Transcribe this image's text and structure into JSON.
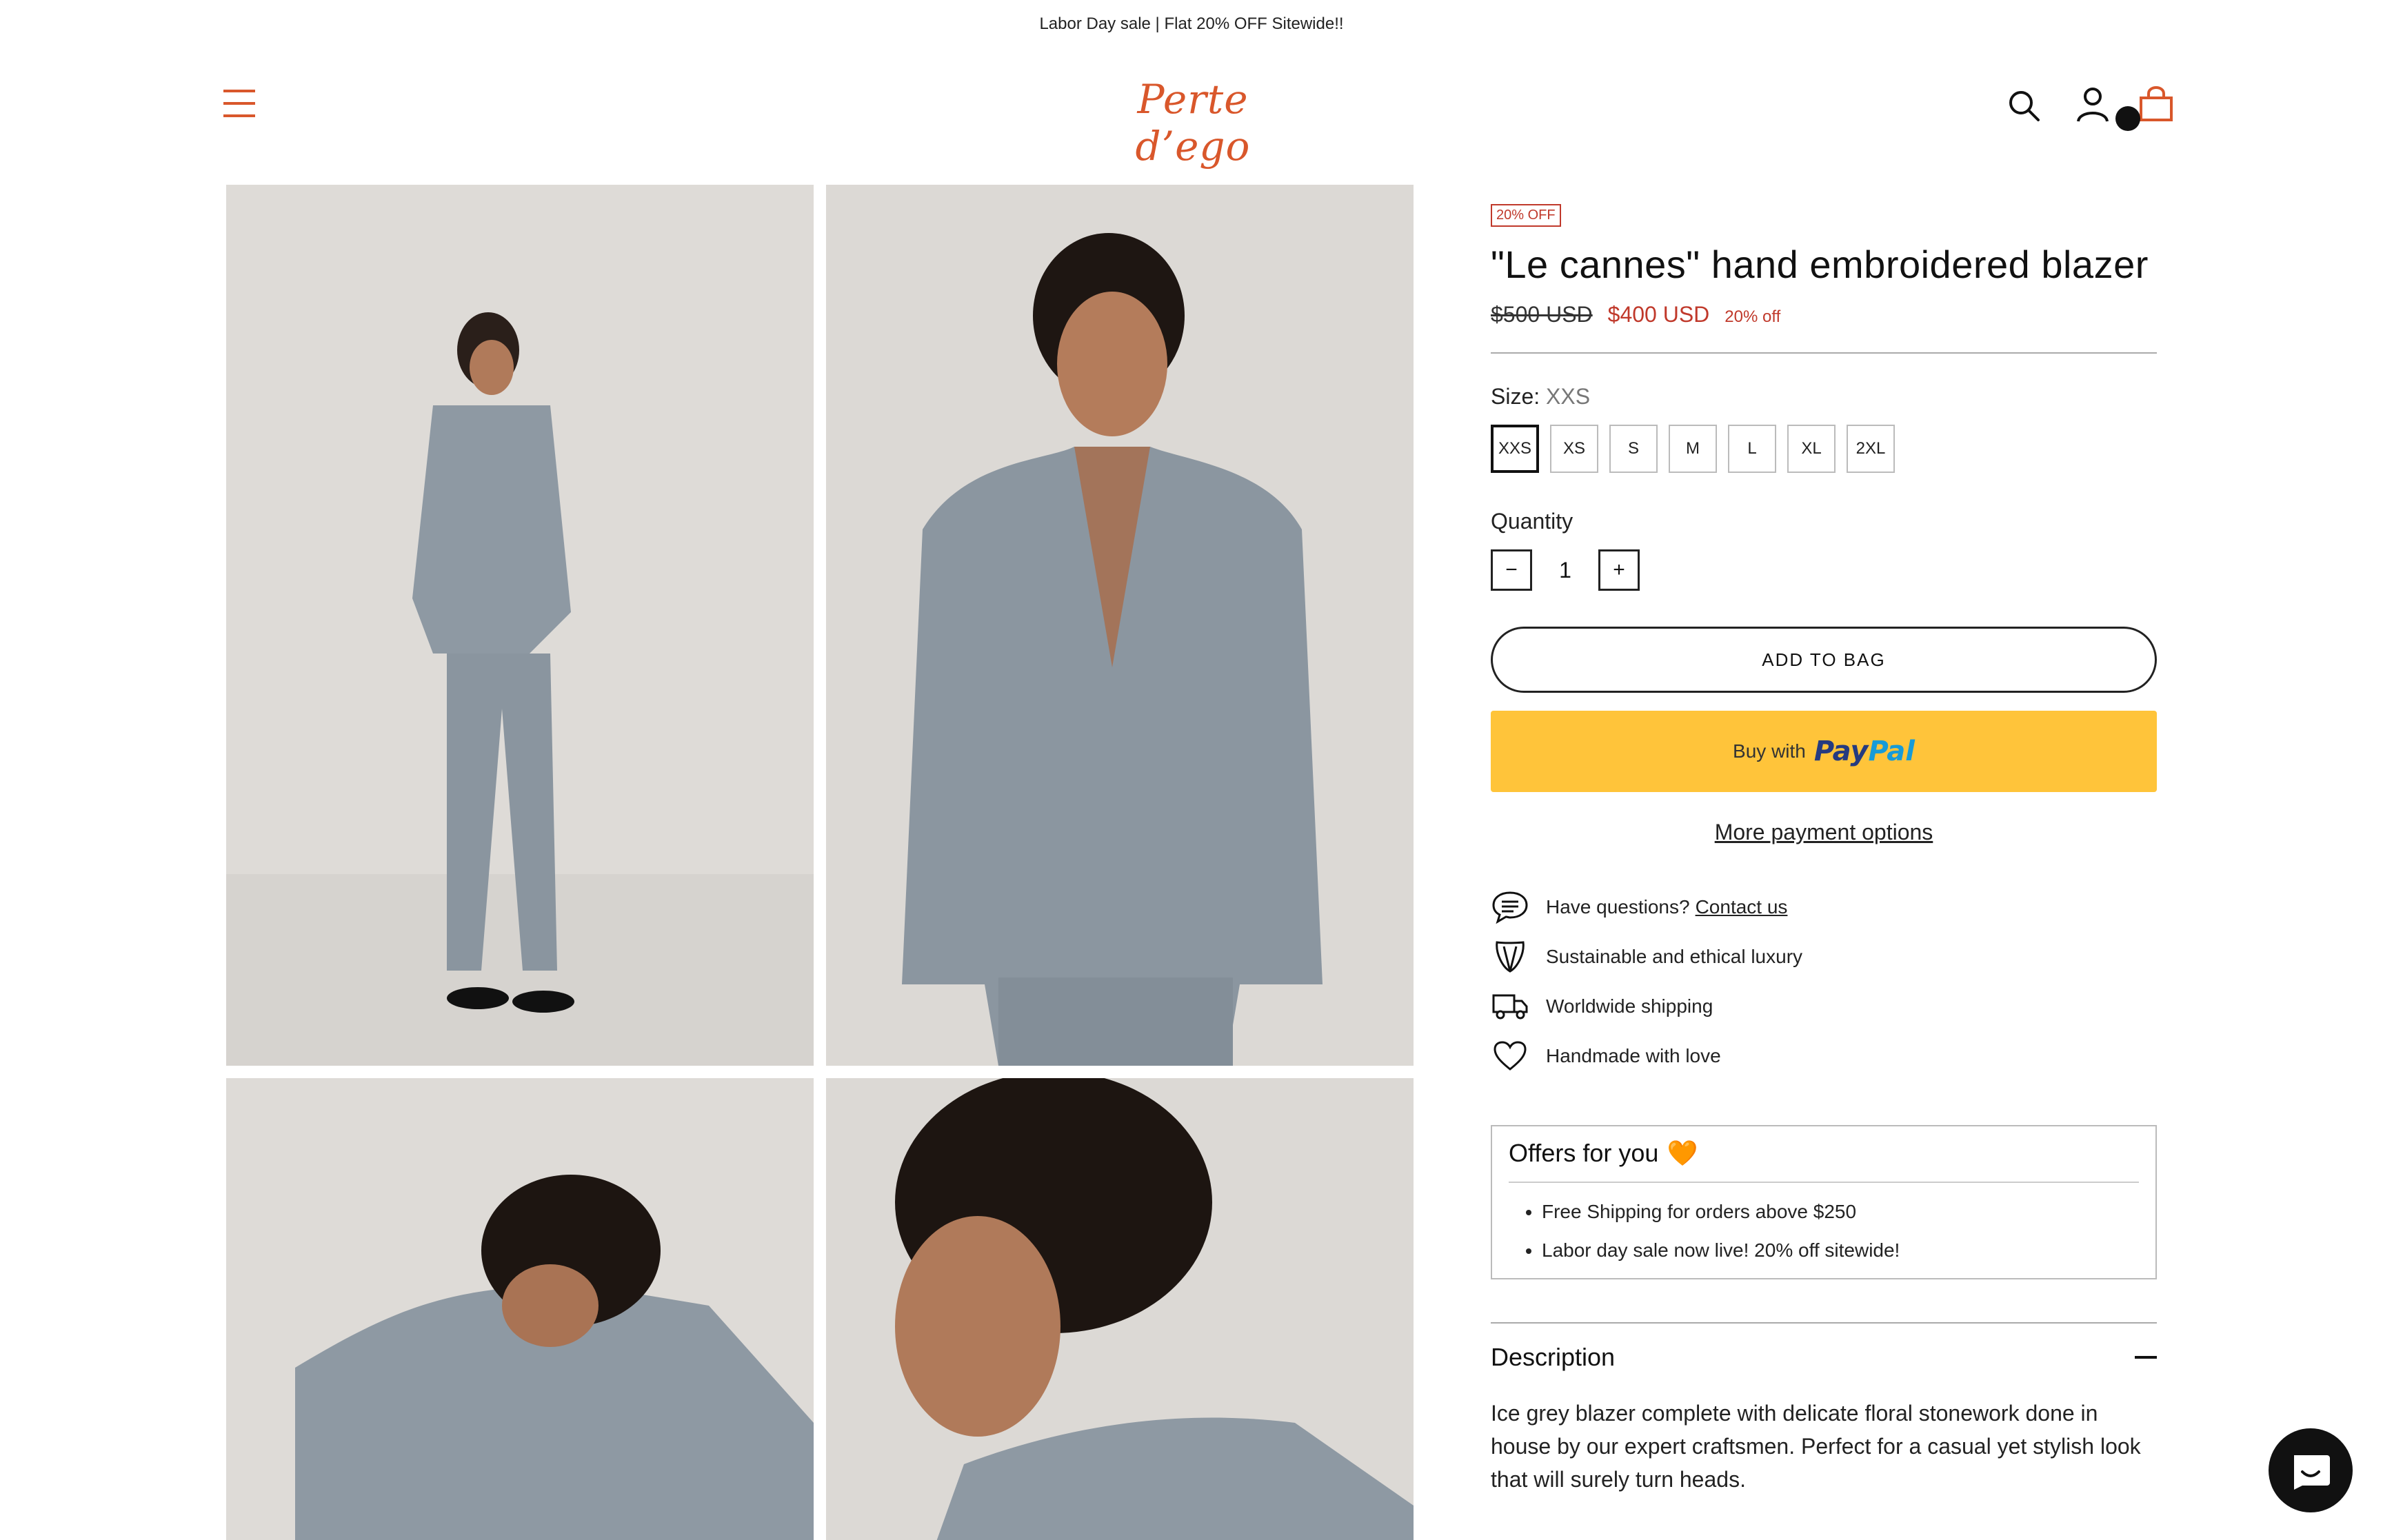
{
  "announcement": "Labor Day sale | Flat 20% OFF Sitewide!!",
  "header": {
    "logo": "Perte d’ego"
  },
  "product": {
    "badge": "20% OFF",
    "title": "\"Le cannes\" hand embroidered blazer",
    "old_price": "$500 USD",
    "new_price": "$400 USD",
    "discount": "20% off",
    "size_label": "Size:",
    "selected_size": "XXS",
    "sizes": [
      "XXS",
      "XS",
      "S",
      "M",
      "L",
      "XL",
      "2XL"
    ],
    "quantity_label": "Quantity",
    "quantity": "1",
    "minus": "−",
    "plus": "+",
    "add_to_bag": "ADD TO BAG",
    "buy_with": "Buy with",
    "paypal_a": "Pay",
    "paypal_b": "Pal",
    "more_payment": "More payment options"
  },
  "features": {
    "questions": "Have questions?",
    "contact": "Contact us",
    "sustainable": "Sustainable and ethical luxury",
    "shipping": "Worldwide shipping",
    "handmade": "Handmade with love"
  },
  "offers": {
    "title": "Offers for you",
    "emoji": "🧡",
    "items": [
      "Free Shipping for orders above $250",
      "Labor day sale now live! 20% off sitewide!"
    ]
  },
  "description": {
    "title": "Description",
    "text": "Ice grey blazer complete with delicate floral stonework done in house by our expert craftsmen. Perfect for a casual yet stylish look that will surely turn heads."
  },
  "colors": {
    "brand": "#d9572b",
    "sale": "#c0392b",
    "paypal_yellow": "#ffc43a"
  }
}
